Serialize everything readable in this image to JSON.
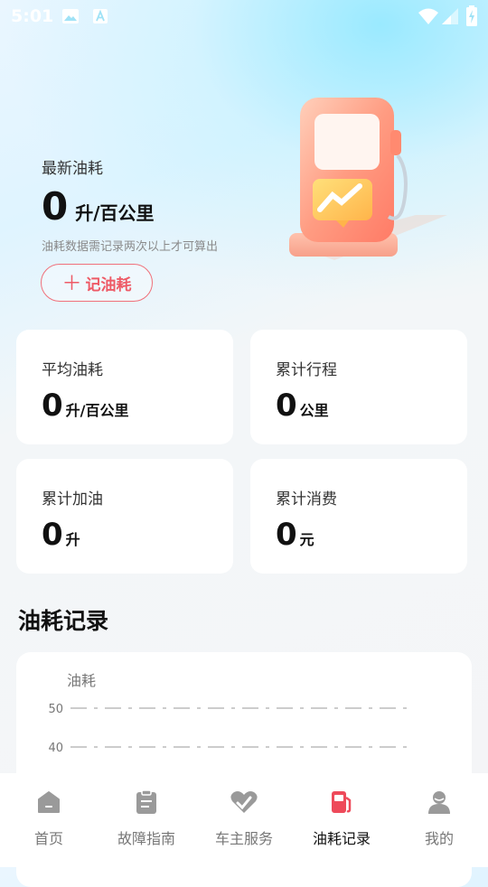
{
  "status_bar": {
    "time": "5:01"
  },
  "hero": {
    "label": "最新油耗",
    "value": "0",
    "unit": "升/百公里",
    "note": "油耗数据需记录两次以上才可算出",
    "record_button": {
      "icon": "plus-icon",
      "label": "记油耗"
    }
  },
  "stats": [
    {
      "label": "平均油耗",
      "value": "0",
      "unit": "升/百公里"
    },
    {
      "label": "累计行程",
      "value": "0",
      "unit": "公里"
    },
    {
      "label": "累计加油",
      "value": "0",
      "unit": "升"
    },
    {
      "label": "累计消费",
      "value": "0",
      "unit": "元"
    }
  ],
  "records": {
    "title": "油耗记录",
    "chart_data": {
      "type": "line",
      "ylabel": "油耗",
      "yticks": [
        "50",
        "40"
      ],
      "series": [],
      "grid": true
    }
  },
  "tabbar": {
    "items": [
      {
        "label": "首页",
        "icon": "home-icon",
        "active": false
      },
      {
        "label": "故障指南",
        "icon": "clipboard-icon",
        "active": false
      },
      {
        "label": "车主服务",
        "icon": "wrench-heart-icon",
        "active": false
      },
      {
        "label": "油耗记录",
        "icon": "fuel-pump-icon",
        "active": true
      },
      {
        "label": "我的",
        "icon": "user-icon",
        "active": false
      }
    ]
  },
  "colors": {
    "accent": "#ee5a66",
    "tab_inactive": "#9a9a9a"
  }
}
